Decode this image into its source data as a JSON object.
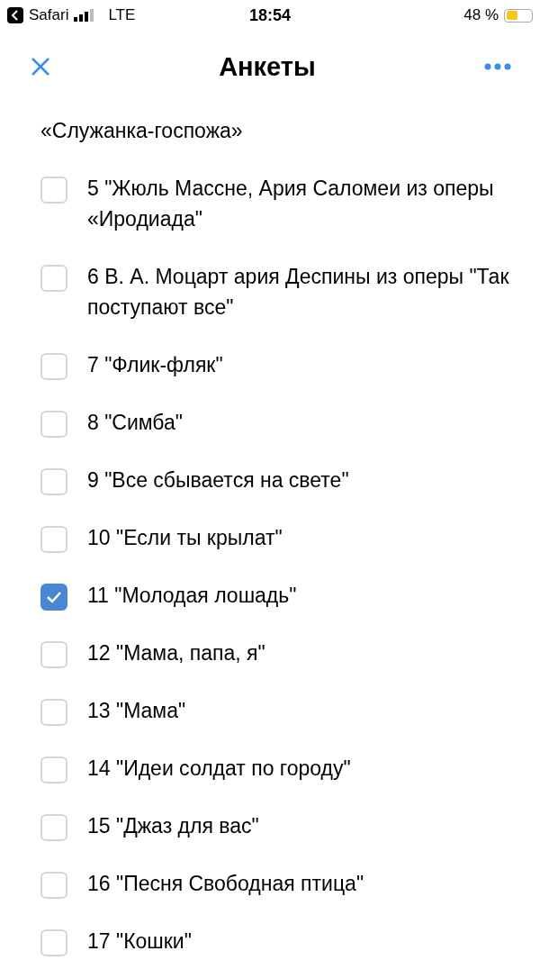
{
  "status_bar": {
    "back_app": "Safari",
    "network": "LTE",
    "time": "18:54",
    "battery": "48 %"
  },
  "header": {
    "title": "Анкеты"
  },
  "continuation": "«Служанка-госпожа»",
  "options": [
    {
      "label": "5 \"Жюль Массне, Ария Саломеи из оперы «Иродиада\"",
      "checked": false
    },
    {
      "label": "6 В. А. Моцарт ария Деспины из оперы \"Так поступают все\"",
      "checked": false
    },
    {
      "label": "7 \"Флик-фляк\"",
      "checked": false
    },
    {
      "label": "8 \"Симба\"",
      "checked": false
    },
    {
      "label": "9 \"Все сбывается на свете\"",
      "checked": false
    },
    {
      "label": "10 \"Если ты крылат\"",
      "checked": false
    },
    {
      "label": "11 \"Молодая лошадь\"",
      "checked": true
    },
    {
      "label": "12 \"Мама, папа, я\"",
      "checked": false
    },
    {
      "label": "13 \"Мама\"",
      "checked": false
    },
    {
      "label": "14 \"Идеи солдат по городу\"",
      "checked": false
    },
    {
      "label": "15 \"Джаз для вас\"",
      "checked": false
    },
    {
      "label": "16 \"Песня Свободная птица\"",
      "checked": false
    },
    {
      "label": "17 \"Кошки\"",
      "checked": false
    }
  ]
}
